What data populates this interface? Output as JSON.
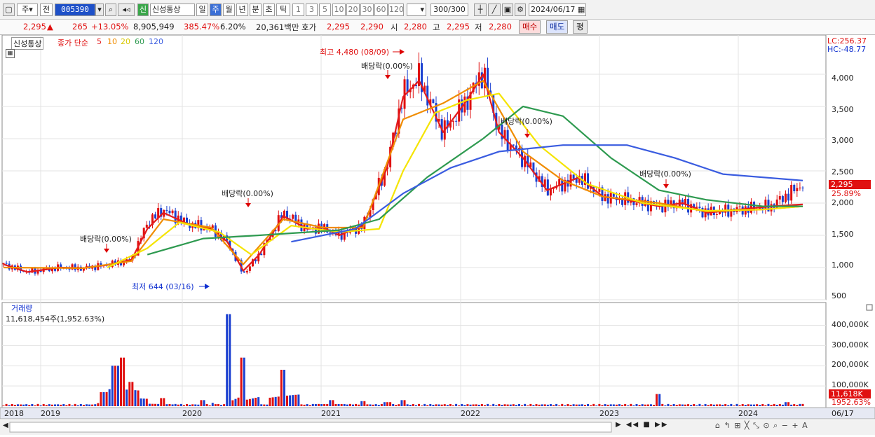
{
  "toolbar": {
    "period_sel": "주",
    "prev": "전",
    "code": "005390",
    "name_tag": "신",
    "name": "신성통상",
    "periods": [
      "일",
      "주",
      "월",
      "년",
      "분",
      "초",
      "틱"
    ],
    "active_period": "주",
    "nums": [
      "1",
      "3",
      "5",
      "10",
      "20",
      "30",
      "60",
      "120"
    ],
    "count": "300/300",
    "date": "2024/06/17"
  },
  "quote": {
    "price": "2,295",
    "change": "265",
    "change_pct": "+13.05%",
    "volume": "8,905,949",
    "vol_ratio": "385.47%",
    "turnover": "6.20%",
    "amount": "20,361백만",
    "bid_label": "호가",
    "ask": "2,295",
    "bid": "2,290",
    "open_label": "시",
    "open": "2,280",
    "high_label": "고",
    "high": "2,295",
    "low_label": "저",
    "low": "2,280",
    "buy": "매수",
    "sell": "매도",
    "eval": "평"
  },
  "legend": {
    "name": "신성통상",
    "ma_label": "종가 단순",
    "mas": [
      "5",
      "10",
      "20",
      "60",
      "120"
    ],
    "volume_title": "거래량",
    "volume_info": "11,618,454주(1,952.63%)"
  },
  "annotations": {
    "high": "최고 4,480 (08/09)",
    "low": "최저 644 (03/16)",
    "div": "배당락(0.00%)",
    "lc": "LC:256.37",
    "hc": "HC:-48.77"
  },
  "price_axis": [
    "4,000",
    "3,500",
    "3,000",
    "2,500",
    "2,000",
    "1,500",
    "1,000",
    "500"
  ],
  "volume_axis": [
    "400,000K",
    "300,000K",
    "200,000K",
    "100,000K"
  ],
  "tags": {
    "price": "2,295",
    "pct": "25.89%",
    "vol": "11,618K",
    "vol_pct": "1952.63%"
  },
  "x_axis": {
    "labels": [
      "2018",
      "2019",
      "2020",
      "2021",
      "2022",
      "2023",
      "2024"
    ],
    "end": "06/17"
  },
  "colors": {
    "candle_up": "#e01010",
    "candle_down": "#1a3fd0",
    "ma5": "#e31a1c",
    "ma10": "#f08c00",
    "ma20": "#f5e400",
    "ma60": "#2e9a50",
    "ma120": "#3a5ce0"
  },
  "chart_data": {
    "type": "candlestick",
    "xlabels": [
      "2018",
      "2019",
      "2020",
      "2021",
      "2022",
      "2023",
      "2024",
      "06/17"
    ],
    "ylim": [
      500,
      4500
    ],
    "key_points": [
      {
        "label": "최고",
        "value": 4480,
        "date": "08/09"
      },
      {
        "label": "최저",
        "value": 644,
        "date": "03/16"
      }
    ],
    "series": [
      {
        "name": "가격",
        "points": [
          [
            0,
            1050
          ],
          [
            0.03,
            930
          ],
          [
            0.07,
            1000
          ],
          [
            0.1,
            990
          ],
          [
            0.13,
            1040
          ],
          [
            0.16,
            1120
          ],
          [
            0.18,
            1700
          ],
          [
            0.2,
            1900
          ],
          [
            0.23,
            1680
          ],
          [
            0.26,
            1600
          ],
          [
            0.28,
            1400
          ],
          [
            0.3,
            900
          ],
          [
            0.32,
            1200
          ],
          [
            0.35,
            1850
          ],
          [
            0.38,
            1600
          ],
          [
            0.4,
            1620
          ],
          [
            0.42,
            1500
          ],
          [
            0.45,
            1650
          ],
          [
            0.48,
            2600
          ],
          [
            0.5,
            3700
          ],
          [
            0.52,
            3950
          ],
          [
            0.55,
            3100
          ],
          [
            0.58,
            3600
          ],
          [
            0.6,
            4050
          ],
          [
            0.62,
            3100
          ],
          [
            0.65,
            2700
          ],
          [
            0.68,
            2200
          ],
          [
            0.72,
            2400
          ],
          [
            0.75,
            2100
          ],
          [
            0.78,
            2050
          ],
          [
            0.82,
            1950
          ],
          [
            0.85,
            2000
          ],
          [
            0.88,
            1850
          ],
          [
            0.92,
            1900
          ],
          [
            0.96,
            1950
          ],
          [
            1.0,
            2295
          ]
        ]
      },
      {
        "name": "5",
        "points": [
          [
            0,
            1050
          ],
          [
            0.03,
            930
          ],
          [
            0.07,
            1000
          ],
          [
            0.1,
            990
          ],
          [
            0.13,
            1040
          ],
          [
            0.16,
            1120
          ],
          [
            0.18,
            1600
          ],
          [
            0.2,
            1850
          ],
          [
            0.23,
            1680
          ],
          [
            0.26,
            1600
          ],
          [
            0.28,
            1400
          ],
          [
            0.3,
            950
          ],
          [
            0.32,
            1200
          ],
          [
            0.35,
            1800
          ],
          [
            0.38,
            1600
          ],
          [
            0.4,
            1620
          ],
          [
            0.42,
            1500
          ],
          [
            0.45,
            1650
          ],
          [
            0.48,
            2550
          ],
          [
            0.5,
            3650
          ],
          [
            0.52,
            3900
          ],
          [
            0.55,
            3100
          ],
          [
            0.58,
            3600
          ],
          [
            0.6,
            4000
          ],
          [
            0.62,
            3100
          ],
          [
            0.65,
            2700
          ],
          [
            0.68,
            2200
          ],
          [
            0.72,
            2400
          ],
          [
            0.75,
            2100
          ],
          [
            0.78,
            2050
          ],
          [
            0.82,
            1950
          ],
          [
            0.85,
            2000
          ],
          [
            0.88,
            1850
          ],
          [
            0.92,
            1900
          ],
          [
            0.96,
            1950
          ],
          [
            1.0,
            1980
          ]
        ]
      },
      {
        "name": "10",
        "points": [
          [
            0,
            1000
          ],
          [
            0.1,
            990
          ],
          [
            0.16,
            1100
          ],
          [
            0.2,
            1750
          ],
          [
            0.26,
            1620
          ],
          [
            0.3,
            1050
          ],
          [
            0.35,
            1750
          ],
          [
            0.4,
            1620
          ],
          [
            0.45,
            1620
          ],
          [
            0.5,
            3300
          ],
          [
            0.55,
            3550
          ],
          [
            0.6,
            3900
          ],
          [
            0.65,
            2800
          ],
          [
            0.7,
            2350
          ],
          [
            0.75,
            2100
          ],
          [
            0.82,
            2000
          ],
          [
            0.88,
            1870
          ],
          [
            0.95,
            1900
          ],
          [
            1.0,
            1950
          ]
        ]
      },
      {
        "name": "20",
        "points": [
          [
            0.13,
            1000
          ],
          [
            0.18,
            1300
          ],
          [
            0.22,
            1700
          ],
          [
            0.27,
            1550
          ],
          [
            0.31,
            1200
          ],
          [
            0.36,
            1650
          ],
          [
            0.42,
            1550
          ],
          [
            0.47,
            1600
          ],
          [
            0.5,
            2500
          ],
          [
            0.54,
            3400
          ],
          [
            0.58,
            3600
          ],
          [
            0.62,
            3700
          ],
          [
            0.67,
            2900
          ],
          [
            0.73,
            2300
          ],
          [
            0.8,
            2000
          ],
          [
            0.88,
            1880
          ],
          [
            0.95,
            1900
          ],
          [
            1.0,
            1950
          ]
        ]
      },
      {
        "name": "60",
        "points": [
          [
            0.18,
            1200
          ],
          [
            0.25,
            1450
          ],
          [
            0.32,
            1500
          ],
          [
            0.42,
            1580
          ],
          [
            0.47,
            1750
          ],
          [
            0.53,
            2400
          ],
          [
            0.6,
            3000
          ],
          [
            0.65,
            3500
          ],
          [
            0.7,
            3350
          ],
          [
            0.76,
            2700
          ],
          [
            0.82,
            2200
          ],
          [
            0.88,
            2050
          ],
          [
            0.95,
            1950
          ],
          [
            1.0,
            1950
          ]
        ]
      },
      {
        "name": "120",
        "points": [
          [
            0.36,
            1400
          ],
          [
            0.44,
            1600
          ],
          [
            0.5,
            2150
          ],
          [
            0.56,
            2550
          ],
          [
            0.62,
            2800
          ],
          [
            0.7,
            2900
          ],
          [
            0.78,
            2900
          ],
          [
            0.84,
            2700
          ],
          [
            0.9,
            2450
          ],
          [
            1.0,
            2350
          ]
        ]
      }
    ],
    "volume_k": [
      [
        0.12,
        15
      ],
      [
        0.14,
        200
      ],
      [
        0.15,
        240
      ],
      [
        0.16,
        120
      ],
      [
        0.2,
        40
      ],
      [
        0.25,
        30
      ],
      [
        0.28,
        455
      ],
      [
        0.3,
        240
      ],
      [
        0.35,
        180
      ],
      [
        0.41,
        30
      ],
      [
        0.45,
        25
      ],
      [
        0.48,
        20
      ],
      [
        0.5,
        30
      ],
      [
        0.82,
        60
      ],
      [
        0.98,
        20
      ],
      [
        1.0,
        11
      ]
    ]
  }
}
